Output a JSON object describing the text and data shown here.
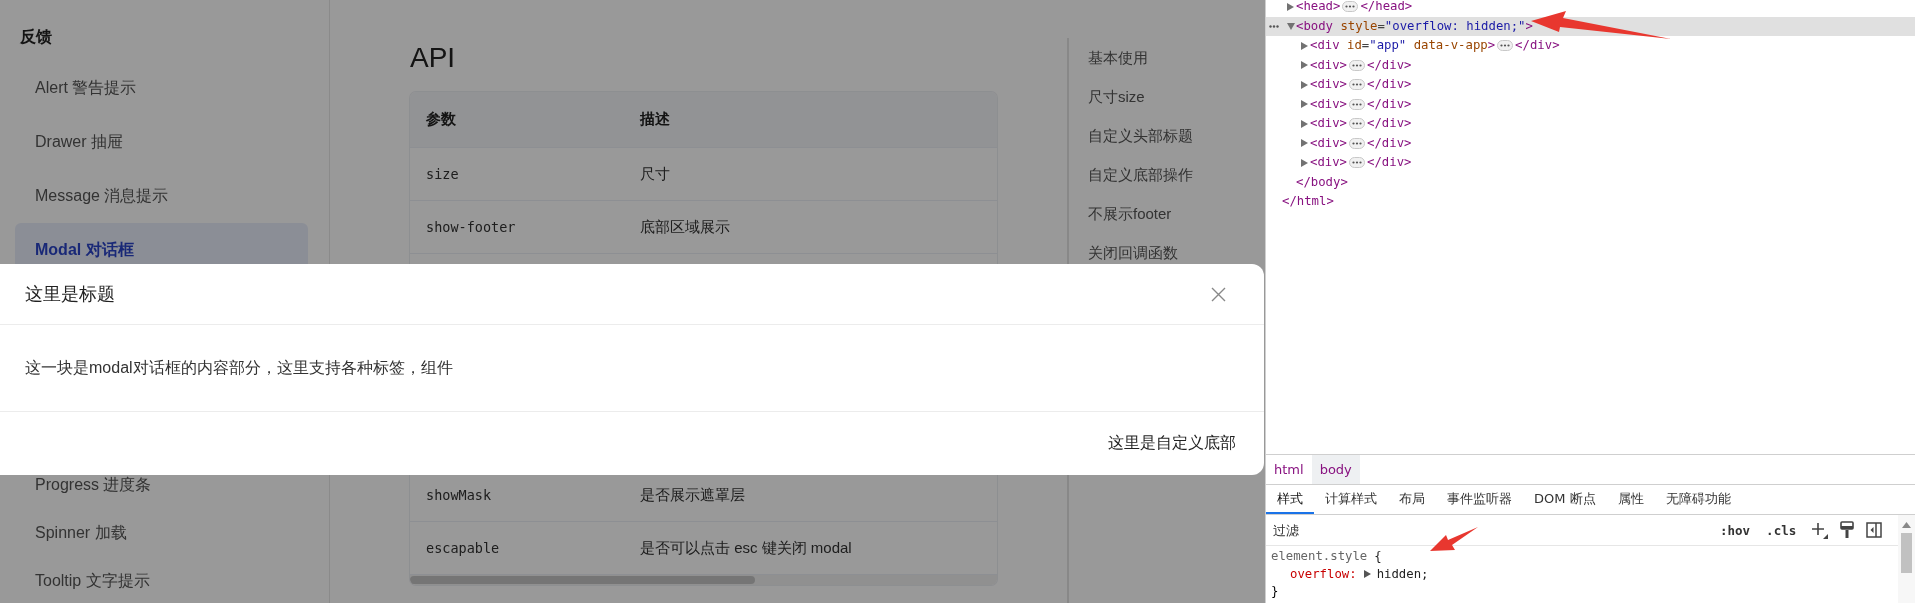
{
  "sidebar": {
    "heading": "反馈",
    "items": [
      {
        "label": "Alert 警告提示",
        "selected": false
      },
      {
        "label": "Drawer 抽屉",
        "selected": false
      },
      {
        "label": "Message 消息提示",
        "selected": false
      },
      {
        "label": "Modal 对话框",
        "selected": true
      },
      {
        "label": "Progress 进度条",
        "selected": false
      },
      {
        "label": "Spinner 加载",
        "selected": false
      },
      {
        "label": "Tooltip 文字提示",
        "selected": false
      }
    ]
  },
  "content": {
    "title": "API",
    "table": {
      "columns": [
        "参数",
        "描述"
      ],
      "rows": [
        [
          "size",
          "尺寸"
        ],
        [
          "show-footer",
          "底部区域展示"
        ],
        [
          "showMask",
          "是否展示遮罩层"
        ],
        [
          "escapable",
          "是否可以点击 esc 键关闭 modal"
        ]
      ]
    }
  },
  "anchor_nav": {
    "items": [
      "基本使用",
      "尺寸size",
      "自定义头部标题",
      "自定义底部操作",
      "不展示footer",
      "关闭回调函数"
    ]
  },
  "modal": {
    "title": "这里是标题",
    "body": "这一块是modal对话框的内容部分，这里支持各种标签，组件",
    "footer": "这里是自定义底部"
  },
  "devtools": {
    "elements_tree": [
      {
        "expanded": false,
        "selected": false,
        "parts": [
          {
            "kind": "tag",
            "text": "<head>"
          },
          {
            "kind": "more"
          },
          {
            "kind": "tag",
            "text": "</head>"
          }
        ]
      },
      {
        "expanded": true,
        "selected": true,
        "parts": [
          {
            "kind": "tag",
            "text": "<body"
          },
          {
            "kind": "attr",
            "text": "style"
          },
          {
            "kind": "punct",
            "text": "="
          },
          {
            "kind": "value",
            "text": "\"overflow: hidden;\""
          },
          {
            "kind": "tag",
            "text": ">"
          }
        ],
        "children": [
          {
            "expanded": false,
            "selected": false,
            "parts": [
              {
                "kind": "tag",
                "text": "<div"
              },
              {
                "kind": "attr",
                "text": "id"
              },
              {
                "kind": "punct",
                "text": "="
              },
              {
                "kind": "value",
                "text": "\"app\""
              },
              {
                "kind": "attr",
                "text": "data-v-app"
              },
              {
                "kind": "tag",
                "text": ">"
              },
              {
                "kind": "more"
              },
              {
                "kind": "tag",
                "text": "</div>"
              }
            ]
          },
          {
            "expanded": false,
            "selected": false,
            "parts": [
              {
                "kind": "tag",
                "text": "<div>"
              },
              {
                "kind": "more"
              },
              {
                "kind": "tag",
                "text": "</div>"
              }
            ]
          },
          {
            "expanded": false,
            "selected": false,
            "parts": [
              {
                "kind": "tag",
                "text": "<div>"
              },
              {
                "kind": "more"
              },
              {
                "kind": "tag",
                "text": "</div>"
              }
            ]
          },
          {
            "expanded": false,
            "selected": false,
            "parts": [
              {
                "kind": "tag",
                "text": "<div>"
              },
              {
                "kind": "more"
              },
              {
                "kind": "tag",
                "text": "</div>"
              }
            ]
          },
          {
            "expanded": false,
            "selected": false,
            "parts": [
              {
                "kind": "tag",
                "text": "<div>"
              },
              {
                "kind": "more"
              },
              {
                "kind": "tag",
                "text": "</div>"
              }
            ]
          },
          {
            "expanded": false,
            "selected": false,
            "parts": [
              {
                "kind": "tag",
                "text": "<div>"
              },
              {
                "kind": "more"
              },
              {
                "kind": "tag",
                "text": "</div>"
              }
            ]
          },
          {
            "expanded": false,
            "selected": false,
            "parts": [
              {
                "kind": "tag",
                "text": "<div>"
              },
              {
                "kind": "more"
              },
              {
                "kind": "tag",
                "text": "</div>"
              }
            ]
          }
        ],
        "closing": [
          {
            "kind": "tag",
            "text": "</body>"
          }
        ]
      }
    ],
    "tree_end": [
      {
        "kind": "tag",
        "text": "</html>"
      }
    ],
    "breadcrumb": [
      {
        "label": "html",
        "selected": false
      },
      {
        "label": "body",
        "selected": true
      }
    ],
    "tabs": [
      {
        "label": "样式",
        "selected": true
      },
      {
        "label": "计算样式",
        "selected": false
      },
      {
        "label": "布局",
        "selected": false
      },
      {
        "label": "事件监听器",
        "selected": false
      },
      {
        "label": "DOM 断点",
        "selected": false
      },
      {
        "label": "属性",
        "selected": false
      },
      {
        "label": "无障碍功能",
        "selected": false
      }
    ],
    "filter": {
      "placeholder": "过滤"
    },
    "tool_buttons": [
      ":hov",
      ".cls"
    ],
    "styles": {
      "selector": "element.style",
      "open_brace": "{",
      "declarations": [
        {
          "property": "overflow:",
          "value": "hidden;"
        }
      ],
      "close_brace": "}"
    }
  }
}
